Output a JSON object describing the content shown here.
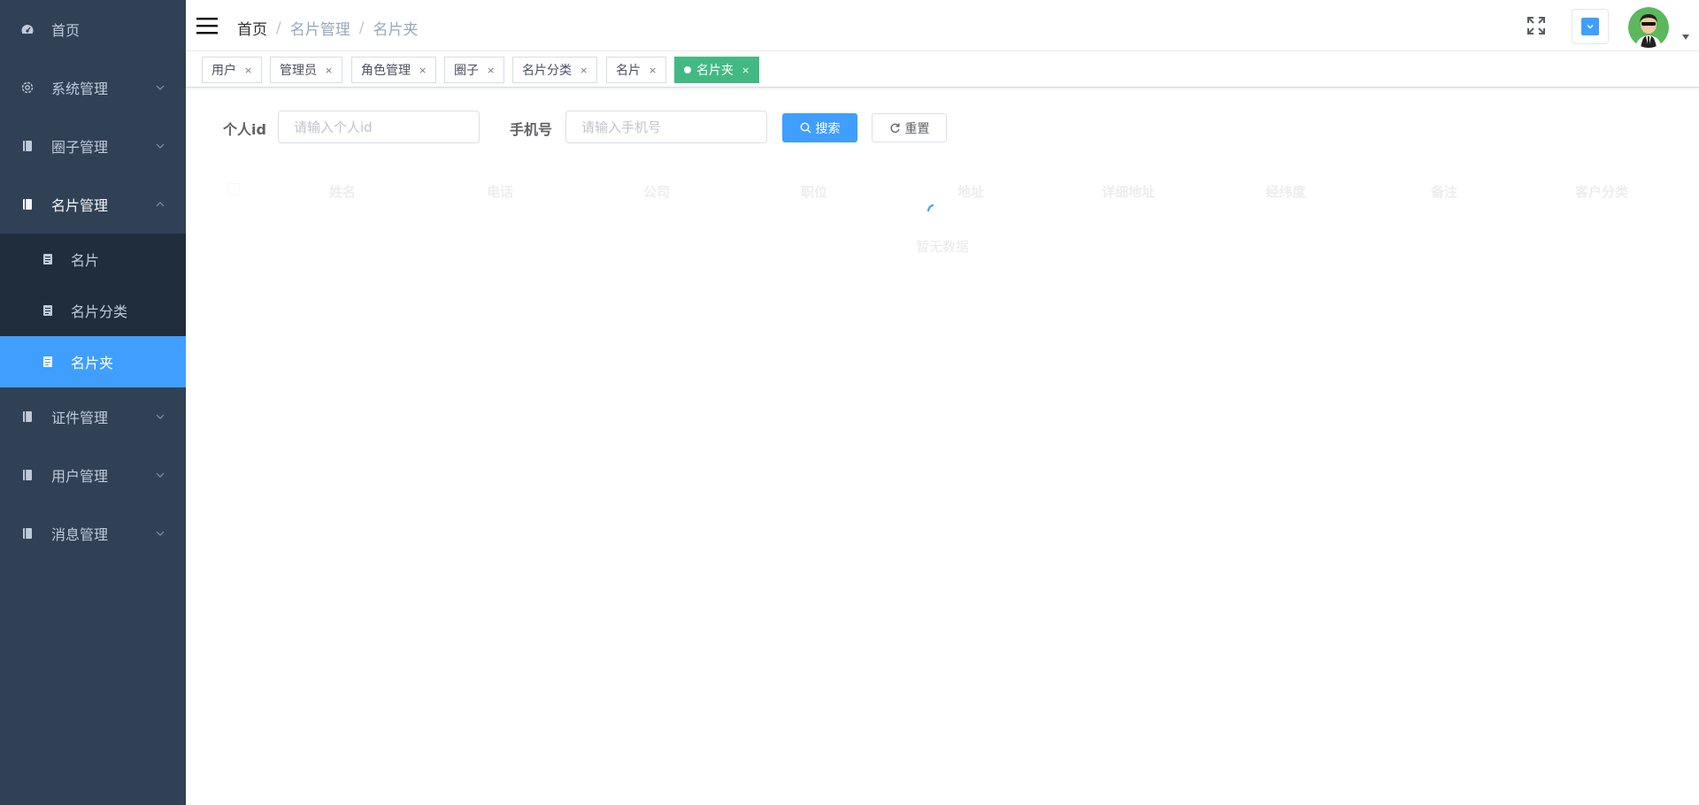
{
  "sidebar": {
    "items": [
      {
        "label": "首页",
        "icon": "dashboard-icon"
      },
      {
        "label": "系统管理",
        "icon": "gear-icon"
      },
      {
        "label": "圈子管理",
        "icon": "book-icon"
      },
      {
        "label": "名片管理",
        "icon": "book-icon",
        "expanded": true,
        "children": [
          {
            "label": "名片",
            "icon": "card-icon"
          },
          {
            "label": "名片分类",
            "icon": "card-icon"
          },
          {
            "label": "名片夹",
            "icon": "card-icon",
            "active": true
          }
        ]
      },
      {
        "label": "证件管理",
        "icon": "book-icon"
      },
      {
        "label": "用户管理",
        "icon": "book-icon"
      },
      {
        "label": "消息管理",
        "icon": "book-icon"
      }
    ]
  },
  "navbar": {
    "breadcrumb": [
      "首页",
      "名片管理",
      "名片夹"
    ],
    "breadcrumb_separator": "/"
  },
  "tags": [
    {
      "label": "用户",
      "close": "×"
    },
    {
      "label": "管理员",
      "close": "×"
    },
    {
      "label": "角色管理",
      "close": "×"
    },
    {
      "label": "圈子",
      "close": "×"
    },
    {
      "label": "名片分类",
      "close": "×"
    },
    {
      "label": "名片",
      "close": "×"
    },
    {
      "label": "名片夹",
      "close": "×",
      "active": true
    }
  ],
  "search": {
    "personal_id_label": "个人id",
    "personal_id_placeholder": "请输入个人id",
    "personal_id_value": "",
    "phone_label": "手机号",
    "phone_placeholder": "请输入手机号",
    "phone_value": "",
    "search_button": "搜索",
    "reset_button": "重置"
  },
  "table": {
    "columns": [
      "姓名",
      "电话",
      "公司",
      "职位",
      "地址",
      "详细地址",
      "经纬度",
      "备注",
      "客户分类"
    ],
    "empty_text": "暂无数据",
    "loading": true
  },
  "colors": {
    "sidebar_bg": "#304156",
    "sidebar_active": "#409eff",
    "tag_active": "#42b983",
    "primary": "#409eff"
  }
}
